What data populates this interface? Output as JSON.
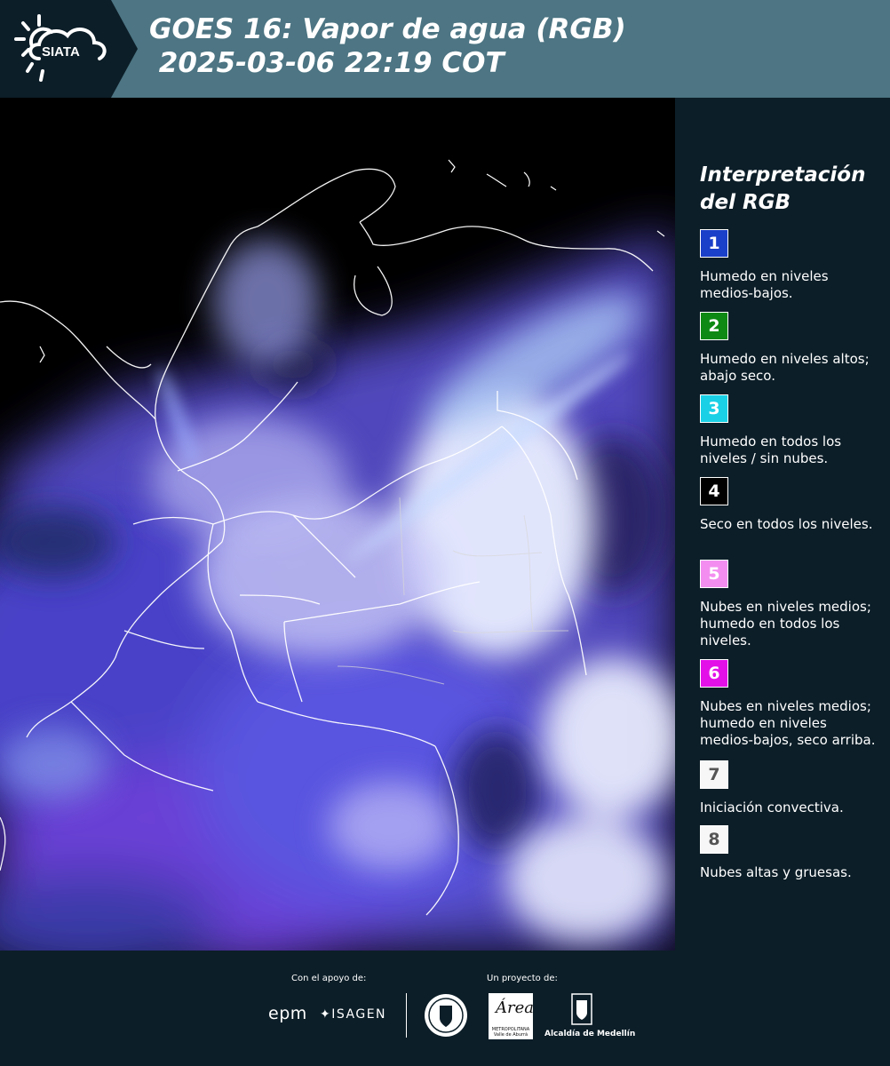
{
  "header": {
    "logo_text": "SIATA",
    "title_line1": "GOES 16: Vapor de agua (RGB)",
    "title_line2": " 2025-03-06 22:19 COT"
  },
  "legend": {
    "title": "Interpretación del RGB",
    "items": [
      {
        "number": "1",
        "color": "#1a3fc8",
        "text_color": "#ffffff",
        "label": "Humedo en niveles medios-bajos."
      },
      {
        "number": "2",
        "color": "#0e8a14",
        "text_color": "#ffffff",
        "label": "Humedo en niveles altos; abajo seco."
      },
      {
        "number": "3",
        "color": "#1ad0e6",
        "text_color": "#ffffff",
        "label": "Humedo en todos los niveles / sin nubes."
      },
      {
        "number": "4",
        "color": "#000000",
        "text_color": "#ffffff",
        "label": "Seco en todos los niveles."
      },
      {
        "number": "5",
        "color": "#f38ef0",
        "text_color": "#ffffff",
        "label": "Nubes en niveles medios; humedo en todos los niveles."
      },
      {
        "number": "6",
        "color": "#e310e8",
        "text_color": "#ffffff",
        "label": "Nubes en niveles medios; humedo en niveles medios-bajos, seco arriba."
      },
      {
        "number": "7",
        "color": "#f7f7f7",
        "text_color": "#555555",
        "label": "Iniciación convectiva."
      },
      {
        "number": "8",
        "color": "#f7f7f7",
        "text_color": "#555555",
        "label": "Nubes altas y gruesas."
      }
    ]
  },
  "footer": {
    "support_label": "Con el apoyo de:",
    "project_label": "Un proyecto de:",
    "epm": "epm",
    "isagen": "ISAGEN",
    "area_big": "Área",
    "area_small": "METROPOLITANA Valle de Aburrá",
    "alcaldia": "Alcaldía de Medellín"
  }
}
